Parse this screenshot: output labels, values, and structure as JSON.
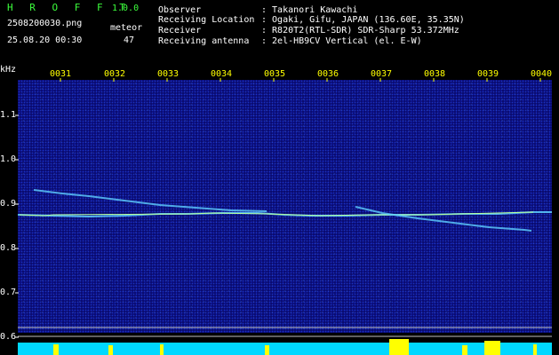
{
  "header": {
    "app_name": "H R O F F T",
    "version": "1.0.0",
    "filename": "2508200030.png",
    "meteor_label": "meteor",
    "datetime": "25.08.20 00:30",
    "meteor_count": "47",
    "info": [
      {
        "key": "Observer",
        "value": ": Takanori Kawachi"
      },
      {
        "key": "Receiving Location",
        "value": ": Ogaki, Gifu, JAPAN (136.60E, 35.35N)"
      },
      {
        "key": "Receiver",
        "value": ": R820T2(RTL-SDR) SDR-Sharp 53.372MHz"
      },
      {
        "key": "Receiving antenna",
        "value": ": 2el-HB9CV Vertical (el. E-W)"
      }
    ]
  },
  "axis": {
    "y_unit": "kHz",
    "y_ticks": [
      "1.1",
      "1.0",
      "0.9",
      "0.8",
      "0.7",
      "0.6"
    ],
    "x_ticks": [
      "0031",
      "0032",
      "0033",
      "0034",
      "0035",
      "0036",
      "0037",
      "0038",
      "0039",
      "0040"
    ]
  },
  "colors": {
    "background": "#000000",
    "spectrum": "#0a0a6e",
    "trace": "#5fd0ff",
    "signal_bar": "#00d8ff",
    "tick": "#ffff00"
  }
}
